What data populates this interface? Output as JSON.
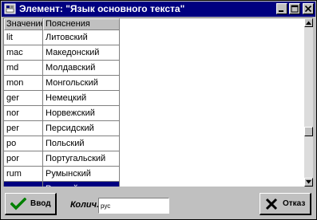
{
  "window": {
    "title": "Элемент: \"Язык основного текста\""
  },
  "table": {
    "headers": {
      "code": "Значение",
      "desc": "Пояснения"
    },
    "rows": [
      {
        "code": "lit",
        "desc": "Литовский"
      },
      {
        "code": "mac",
        "desc": "Македонский"
      },
      {
        "code": "md",
        "desc": "Молдавский"
      },
      {
        "code": "mon",
        "desc": "Монгольский"
      },
      {
        "code": "ger",
        "desc": "Немецкий"
      },
      {
        "code": "nor",
        "desc": "Норвежский"
      },
      {
        "code": "per",
        "desc": "Персидский"
      },
      {
        "code": "po",
        "desc": "Польский"
      },
      {
        "code": "por",
        "desc": "Португальский"
      },
      {
        "code": "rum",
        "desc": "Румынский"
      },
      {
        "code": "rus",
        "desc": "Русский"
      }
    ],
    "selected_code": "rus"
  },
  "bottom": {
    "ok_label": "Ввод",
    "count_label": "Колич.",
    "count_value": "рус",
    "cancel_label": "Отказ"
  },
  "colors": {
    "titlebar": "#000080",
    "selection": "#000080",
    "ok_check": "#008000",
    "face": "#c0c0c0"
  },
  "icons": {
    "title": "app-icon",
    "minimize": "minimize-icon",
    "maximize": "maximize-icon",
    "close": "close-icon",
    "ok": "checkmark-icon",
    "cancel": "x-icon",
    "scroll_up": "arrow-up-icon",
    "scroll_down": "arrow-down-icon"
  }
}
